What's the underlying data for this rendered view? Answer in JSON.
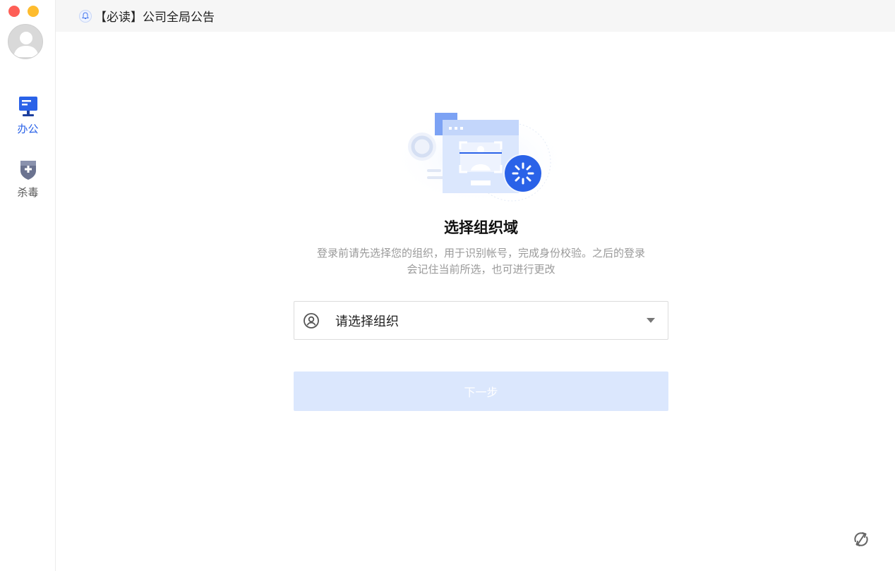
{
  "window": {
    "controls": [
      "close",
      "minimize"
    ]
  },
  "sidebar": {
    "avatar_icon": "user-avatar",
    "items": [
      {
        "label": "办公",
        "icon": "office-monitor-icon",
        "active": true,
        "color": "#2a62e8"
      },
      {
        "label": "杀毒",
        "icon": "antivirus-shield-icon",
        "active": false,
        "color": "#555555"
      }
    ]
  },
  "notice": {
    "icon": "bell-icon",
    "text": "【必读】公司全局公告"
  },
  "main": {
    "illustration": "scan-face-illustration",
    "title": "选择组织域",
    "description_line1": "登录前请先选择您的组织，用于识别帐号，完成身份校验。之后的登录",
    "description_line2": "会记住当前所选，也可进行更改",
    "org_select": {
      "icon": "user-circle-icon",
      "placeholder": "请选择组织"
    },
    "next_button": "下一步"
  },
  "footer": {
    "icon": "sync-icon"
  },
  "colors": {
    "accent": "#2a62e8",
    "button_disabled": "#dbe7fd",
    "traffic_red": "#fe5f57",
    "traffic_yellow": "#febc2e"
  }
}
